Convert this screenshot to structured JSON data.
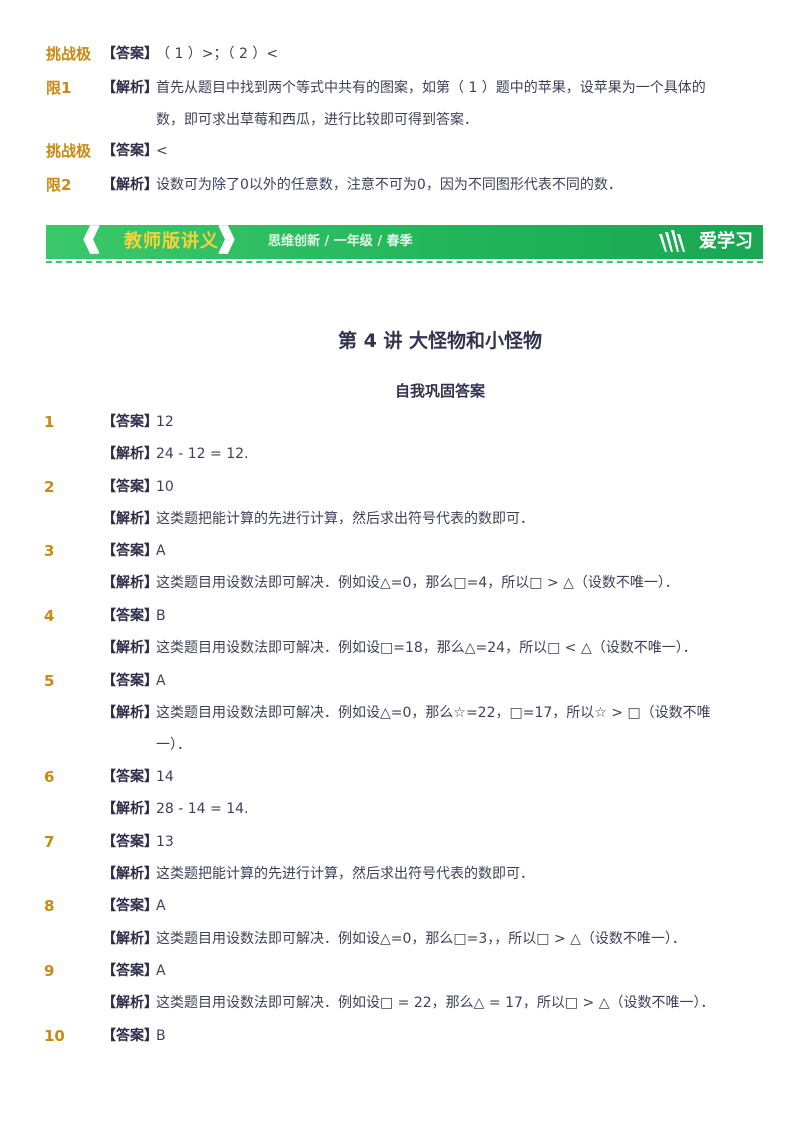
{
  "top": {
    "r1": {
      "level": "挑战极",
      "tag": "【答案】",
      "text": "（ 1 ）>；（ 2 ）<"
    },
    "r2": {
      "level": "限1",
      "tag": "【解析】",
      "text": "首先从题目中找到两个等式中共有的图案，如第（ 1 ）题中的苹果，设苹果为一个具体的",
      "cont": "数，即可求出草莓和西瓜，进行比较即可得到答案．"
    },
    "r3": {
      "level": "挑战极",
      "tag": "【答案】",
      "text": "<"
    },
    "r4": {
      "level": "限2",
      "tag": "【解析】",
      "text": "设数可为除了0以外的任意数，注意不可为0，因为不同图形代表不同的数．"
    }
  },
  "banner": {
    "chev_left": "《《《",
    "title": "教师版讲义",
    "chev_right": "》》》",
    "subtitle": "思维创新 / 一年级 / 春季",
    "brand": "爱学习"
  },
  "heading": "第 4 讲  大怪物和小怪物",
  "subheading": "自我巩固答案",
  "answers": [
    {
      "num": "1",
      "ans_tag": "【答案】",
      "ans": "12",
      "exp_tag": "【解析】",
      "exp": "24 - 12 = 12."
    },
    {
      "num": "2",
      "ans_tag": "【答案】",
      "ans": "10",
      "exp_tag": "【解析】",
      "exp": "这类题把能计算的先进行计算，然后求出符号代表的数即可．"
    },
    {
      "num": "3",
      "ans_tag": "【答案】",
      "ans": "A",
      "exp_tag": "【解析】",
      "exp": "这类题目用设数法即可解决．例如设△=0，那么□=4，所以□ > △（设数不唯一）．"
    },
    {
      "num": "4",
      "ans_tag": "【答案】",
      "ans": "B",
      "exp_tag": "【解析】",
      "exp": "这类题目用设数法即可解决．例如设□=18，那么△=24，所以□ < △（设数不唯一）．"
    },
    {
      "num": "5",
      "ans_tag": "【答案】",
      "ans": "A",
      "exp_tag": "【解析】",
      "exp": "这类题目用设数法即可解决．例如设△=0，那么☆=22，□=17，所以☆ > □（设数不唯",
      "exp_cont": "一）．"
    },
    {
      "num": "6",
      "ans_tag": "【答案】",
      "ans": "14",
      "exp_tag": "【解析】",
      "exp": "28 - 14 = 14."
    },
    {
      "num": "7",
      "ans_tag": "【答案】",
      "ans": "13",
      "exp_tag": "【解析】",
      "exp": "这类题把能计算的先进行计算，然后求出符号代表的数即可．"
    },
    {
      "num": "8",
      "ans_tag": "【答案】",
      "ans": "A",
      "exp_tag": "【解析】",
      "exp": "这类题目用设数法即可解决．例如设△=0，那么□=3，，所以□ > △（设数不唯一）．"
    },
    {
      "num": "9",
      "ans_tag": "【答案】",
      "ans": "A",
      "exp_tag": "【解析】",
      "exp": "这类题目用设数法即可解决．例如设□ = 22，那么△ = 17，所以□ > △（设数不唯一）．"
    },
    {
      "num": "10",
      "ans_tag": "【答案】",
      "ans": "B"
    }
  ],
  "colors": {
    "level": "#c98a12",
    "banner_green": "#22b45a",
    "banner_title": "#f7d23a"
  }
}
